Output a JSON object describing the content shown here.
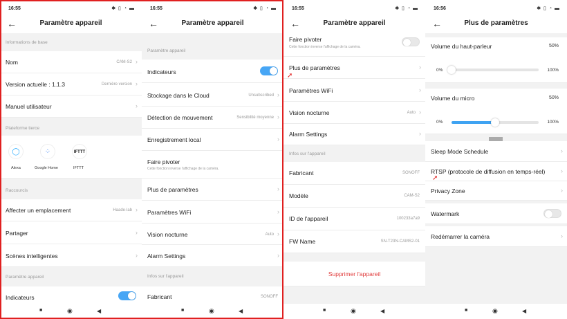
{
  "status": {
    "time1": "16:55",
    "time2": "16:55",
    "time3": "16:55",
    "time4": "16:56",
    "icons": "✱ ▯ ◔ ▬"
  },
  "back_glyph": "←",
  "chevron": "›",
  "nav": {
    "square": "■",
    "circle": "◉",
    "back": "◀"
  },
  "screen1": {
    "title": "Paramètre appareil",
    "section_basic": "Informations de base",
    "nom_label": "Nom",
    "nom_value": "CAM-S2",
    "version_label": "Version actuelle : 1.1.3",
    "version_value": "Dernière version",
    "manual_label": "Manuel utilisateur",
    "section_platform": "Plateforme tierce",
    "alexa": "Alexa",
    "google": "Google Home",
    "ifttt": "IFTTT",
    "ifttt_logo": "IFTTT",
    "section_shortcuts": "Raccourcis",
    "location_label": "Affecter un emplacement",
    "location_value": "Haade-lab",
    "share_label": "Partager",
    "scenes_label": "Scènes intelligentes",
    "section_device": "Paramètre appareil",
    "indicators_label": "Indicateurs"
  },
  "screen2": {
    "title": "Paramètre appareil",
    "section_device": "Paramètre appareil",
    "indicators_label": "Indicateurs",
    "cloud_label": "Stockage dans le Cloud",
    "cloud_value": "Unsubscribed",
    "motion_label": "Détection de mouvement",
    "motion_value": "Sensibilité moyenne",
    "local_label": "Enregistrement local",
    "rotate_label": "Faire pivoter",
    "rotate_sub": "Cette fonction inverse l'affichage de la caméra.",
    "more_label": "Plus de paramètres",
    "wifi_label": "Paramètres WiFi",
    "night_label": "Vision nocturne",
    "night_value": "Auto",
    "alarm_label": "Alarm Settings",
    "section_info": "Infos sur l'appareil",
    "maker_label": "Fabricant",
    "maker_value": "SONOFF"
  },
  "screen3": {
    "title": "Paramètre appareil",
    "rotate_label": "Faire pivoter",
    "rotate_sub": "Cette fonction inverse l'affichage de la caméra.",
    "more_label": "Plus de paramètres",
    "wifi_label": "Paramètres WiFi",
    "night_label": "Vision nocturne",
    "night_value": "Auto",
    "alarm_label": "Alarm Settings",
    "section_info": "Infos sur l'appareil",
    "maker_label": "Fabricant",
    "maker_value": "SONOFF",
    "model_label": "Modèle",
    "model_value": "CAM-S2",
    "id_label": "ID de l'appareil",
    "id_value": "100233a7a9",
    "fw_label": "FW Name",
    "fw_value": "SN-T23N-CAMS2-01",
    "delete_label": "Supprimer l'appareil"
  },
  "screen4": {
    "title": "Plus de paramètres",
    "speaker_label": "Volume du haut-parleur",
    "speaker_value": "50%",
    "speaker_min": "0%",
    "speaker_max": "100%",
    "speaker_level": 0,
    "mic_label": "Volume du micro",
    "mic_value": "50%",
    "mic_min": "0%",
    "mic_max": "100%",
    "mic_level": 0.5,
    "sleep_label": "Sleep Mode Schedule",
    "rtsp_label": "RTSP (protocole de diffusion en temps-réel)",
    "privacy_label": "Privacy Zone",
    "watermark_label": "Watermark",
    "reboot_label": "Redémarrer la caméra"
  },
  "colors": {
    "accent": "#47a6f5",
    "danger": "#e03a3a",
    "frame": "#e02020"
  }
}
